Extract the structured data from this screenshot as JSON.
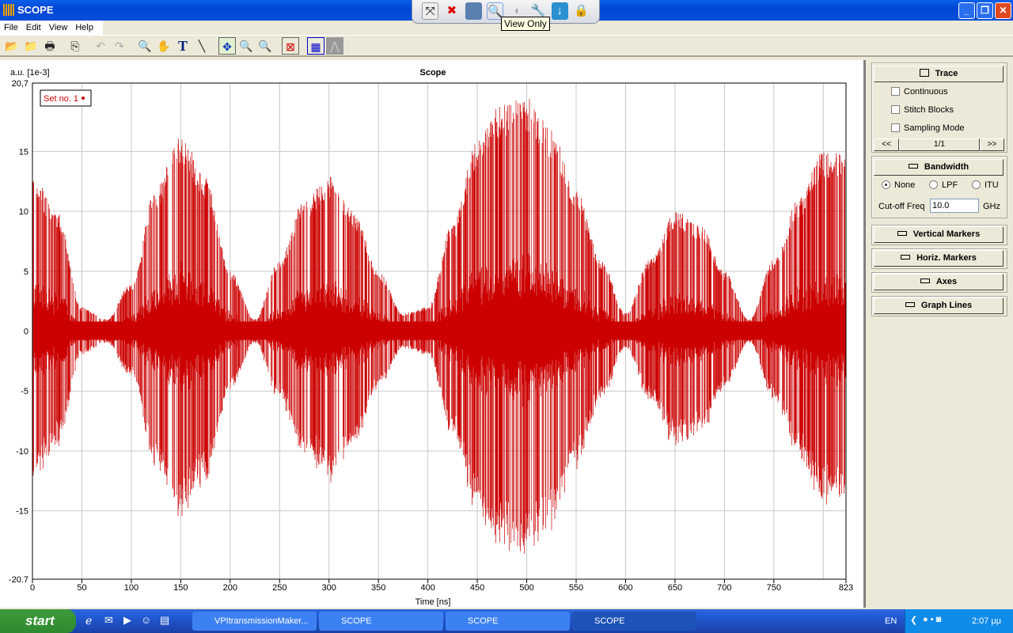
{
  "window": {
    "title": "SCOPE",
    "controls": [
      "minimize",
      "restore",
      "close"
    ]
  },
  "remote_toolbar": {
    "icons": [
      "fit-window-icon",
      "close-session-icon",
      "switch-screen-icon",
      "view-only-icon",
      "mouse-icon",
      "settings-icon",
      "download-icon",
      "lock-icon"
    ],
    "tooltip": "View Only"
  },
  "menu": [
    "File",
    "Edit",
    "View",
    "Help"
  ],
  "toolbar": [
    "open-icon",
    "open-recent-icon",
    "print-icon",
    "copy-icon",
    "undo-icon",
    "redo-icon",
    "zoom-box-icon",
    "pan-hand-icon",
    "text-icon",
    "line-icon",
    "fit-all-icon",
    "zoom-in-icon",
    "zoom-out-icon",
    "reset-view-icon",
    "grid-view-icon",
    "spectrum-icon"
  ],
  "chart_data": {
    "type": "line",
    "title": "Scope",
    "xlabel": "Time [ns]",
    "ylabel": "a.u. [1e-3]",
    "xlim": [
      0,
      823
    ],
    "ylim": [
      -20.7,
      20.7
    ],
    "xticks": [
      "0",
      "50",
      "100",
      "150",
      "200",
      "250",
      "300",
      "350",
      "400",
      "450",
      "500",
      "550",
      "600",
      "650",
      "700",
      "750",
      "823"
    ],
    "yticks": [
      "20,7",
      "15",
      "10",
      "5",
      "0",
      "-5",
      "-10",
      "-15",
      "-20.7"
    ],
    "ytick_values": [
      20.7,
      15,
      10,
      5,
      0,
      -5,
      -10,
      -15,
      -20.7
    ],
    "xtick_values": [
      0,
      50,
      100,
      150,
      200,
      250,
      300,
      350,
      400,
      450,
      500,
      550,
      600,
      650,
      700,
      750,
      823
    ],
    "grid": true,
    "legend": {
      "placement": "top-left",
      "entries": [
        "Set no. 1"
      ]
    },
    "series": [
      {
        "name": "Set no. 1",
        "color": "#cc0000",
        "envelope_time_ns": [
          0,
          25,
          50,
          75,
          100,
          125,
          150,
          175,
          200,
          225,
          250,
          275,
          300,
          325,
          350,
          375,
          400,
          425,
          450,
          475,
          500,
          525,
          550,
          575,
          600,
          625,
          650,
          675,
          700,
          725,
          750,
          775,
          800,
          823
        ],
        "envelope_peak": [
          13,
          10,
          2,
          1,
          4,
          12,
          16.5,
          13,
          5,
          1,
          6,
          11,
          13,
          10,
          5,
          1.5,
          2,
          9,
          16,
          19,
          19.5,
          17,
          12,
          6,
          1.5,
          6,
          10,
          9,
          5,
          1,
          6,
          11,
          15,
          15
        ]
      }
    ]
  },
  "side_panel": {
    "trace": {
      "label": "Trace",
      "continuous": "Continuous",
      "stitch": "Stitch Blocks",
      "sampling": "Sampling Mode",
      "prev": "<<",
      "page": "1/1",
      "next": ">>"
    },
    "bandwidth": {
      "label": "Bandwidth",
      "options": [
        "None",
        "LPF",
        "ITU"
      ],
      "selected": "None",
      "cutoff_label": "Cut-off Freq",
      "cutoff_value": "10.0",
      "unit": "GHz"
    },
    "vertical_markers": "Vertical Markers",
    "horiz_markers": "Horiz. Markers",
    "axes": "Axes",
    "graph_lines": "Graph Lines"
  },
  "taskbar": {
    "start": "start",
    "tasks": [
      "VPItransmissionMaker...",
      "SCOPE",
      "SCOPE",
      "SCOPE"
    ],
    "lang": "EN",
    "clock": "2:07 μμ"
  }
}
